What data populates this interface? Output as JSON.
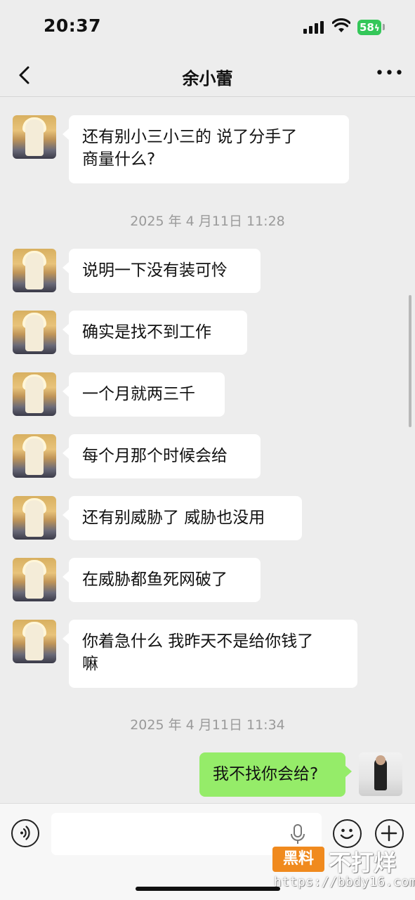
{
  "status_bar": {
    "time": "20:37",
    "battery": "58"
  },
  "nav": {
    "title": "余小蕾"
  },
  "messages": [
    {
      "side": "left",
      "text": "还有别小三小三的  说了分手了\n商量什么?"
    },
    {
      "timestamp": "2025 年 4 月11日 11:28"
    },
    {
      "side": "left",
      "text": "说明一下没有装可怜"
    },
    {
      "side": "left",
      "text": "确实是找不到工作"
    },
    {
      "side": "left",
      "text": "一个月就两三千"
    },
    {
      "side": "left",
      "text": "每个月那个时候会给"
    },
    {
      "side": "left",
      "text": "还有别威胁了  威胁也没用"
    },
    {
      "side": "left",
      "text": "在威胁都鱼死网破了"
    },
    {
      "side": "left",
      "text": "你着急什么  我昨天不是给你钱了\n嘛"
    },
    {
      "timestamp": "2025 年 4 月11日 11:34"
    },
    {
      "side": "right",
      "text": "我不找你会给?"
    }
  ],
  "input": {
    "placeholder": ""
  },
  "watermark": {
    "badge": "黑料",
    "text": "不打烊",
    "url": "https://bbdy16.com"
  },
  "colors": {
    "my_bubble": "#95ec69",
    "other_bubble": "#ffffff",
    "background": "#ededed"
  }
}
